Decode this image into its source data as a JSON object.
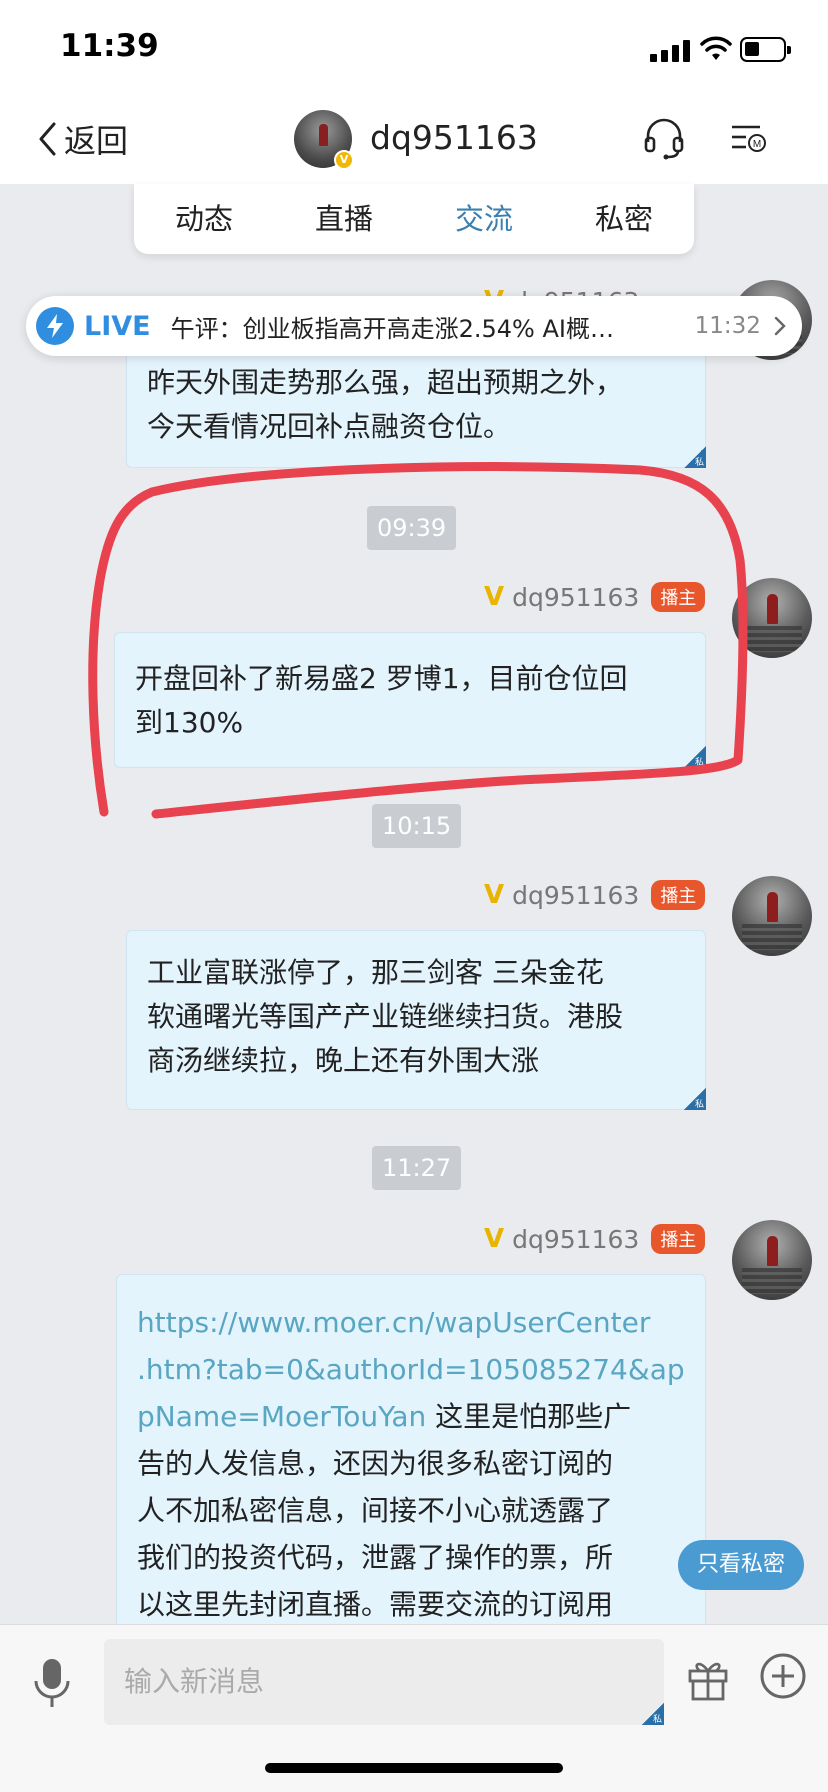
{
  "status_bar": {
    "time": "11:39"
  },
  "nav": {
    "back_label": "返回",
    "title": "dq951163"
  },
  "tabs": [
    {
      "label": "动态",
      "active": false
    },
    {
      "label": "直播",
      "active": false
    },
    {
      "label": "交流",
      "active": true
    },
    {
      "label": "私密",
      "active": false
    }
  ],
  "live_banner": {
    "label": "LIVE",
    "text": "午评：创业板指高开高走涨2.54% AI概…",
    "time": "11:32"
  },
  "messages": {
    "m1": {
      "partial_sender": "dq951163",
      "line1": "昨天外围走势那么强，超出预期之外，",
      "line2": "今天看情况回补点融资仓位。",
      "private_mark": "私"
    },
    "t1": "09:39",
    "m2": {
      "sender": "dq951163",
      "badge": "播主",
      "line1": "开盘回补了新易盛2 罗博1，目前仓位回",
      "line2": "到130%",
      "private_mark": "私"
    },
    "t2": "10:15",
    "m3": {
      "sender": "dq951163",
      "badge": "播主",
      "line1": "工业富联涨停了，那三剑客 三朵金花",
      "line2": "软通曙光等国产产业链继续扫货。港股",
      "line3": "商汤继续拉，晚上还有外围大涨",
      "private_mark": "私"
    },
    "t3": "11:27",
    "m4": {
      "sender": "dq951163",
      "badge": "播主",
      "link1": "https://www.moer.cn/wapUserCenter",
      "link2": ".htm?tab=0&authorId=105085274&ap",
      "link3": "pName=MoerTouYan",
      "text3": " 这里是怕那些广",
      "line4": "告的人发信息，还因为很多私密订阅的",
      "line5": "人不加私密信息，间接不小心就透露了",
      "line6": "我们的投资代码，泄露了操作的票，所",
      "line7": "以这里先封闭直播。需要交流的订阅用"
    }
  },
  "float_button": "只看私密",
  "input": {
    "placeholder": "输入新消息",
    "private_mark": "私"
  },
  "colors": {
    "accent_blue": "#3a7fb2",
    "bubble_bg": "#e4f4fd",
    "host_badge": "#e8562b",
    "annotation_red": "#e8424e",
    "link": "#58a6c2"
  }
}
